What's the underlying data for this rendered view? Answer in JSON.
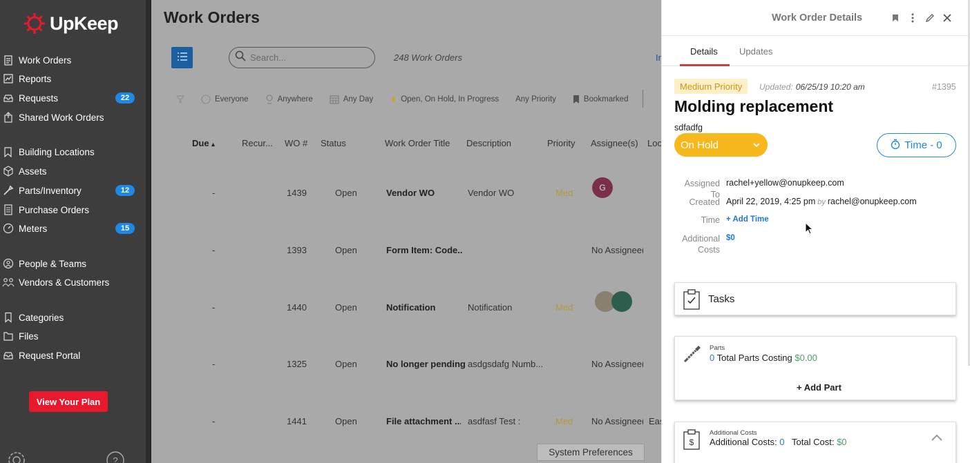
{
  "brand": {
    "name": "UpKeep"
  },
  "sidebar": {
    "items": [
      {
        "label": "Work Orders",
        "icon": "clipboard-icon"
      },
      {
        "label": "Reports",
        "icon": "chart-icon"
      },
      {
        "label": "Requests",
        "icon": "inbox-icon",
        "badge": "22"
      },
      {
        "label": "Shared Work Orders",
        "icon": "share-icon"
      },
      {
        "label": "Building Locations",
        "icon": "location-icon"
      },
      {
        "label": "Assets",
        "icon": "cube-icon"
      },
      {
        "label": "Parts/Inventory",
        "icon": "wrench-icon",
        "badge": "12"
      },
      {
        "label": "Purchase Orders",
        "icon": "document-icon"
      },
      {
        "label": "Meters",
        "icon": "gauge-icon",
        "badge": "15"
      },
      {
        "label": "People & Teams",
        "icon": "people-icon"
      },
      {
        "label": "Vendors & Customers",
        "icon": "vendors-icon"
      },
      {
        "label": "Categories",
        "icon": "bookmark-icon"
      },
      {
        "label": "Files",
        "icon": "files-icon"
      },
      {
        "label": "Request Portal",
        "icon": "portal-icon"
      }
    ],
    "plan_button": "View Your Plan"
  },
  "main": {
    "title": "Work Orders",
    "search_placeholder": "Search...",
    "count_label": "248 Work Orders",
    "cut_link": "In",
    "filters": {
      "everyone": "Everyone",
      "anywhere": "Anywhere",
      "anyday": "Any Day",
      "status": "Open, On Hold, In Progress",
      "priority": "Any Priority",
      "bookmarked": "Bookmarked"
    },
    "columns": {
      "due": "Due",
      "recurring": "Recur...",
      "wo": "WO #",
      "status": "Status",
      "title": "Work Order Title",
      "description": "Description",
      "priority": "Priority",
      "assignees": "Assignee(s)",
      "location": "Loc"
    },
    "rows": [
      {
        "due": "-",
        "wo": "1439",
        "status": "Open",
        "title": "Vendor WO",
        "description": "Vendor WO",
        "priority": "Med",
        "assignee": "",
        "avatar": "G",
        "location": ""
      },
      {
        "due": "-",
        "wo": "1393",
        "status": "Open",
        "title": "Form Item: Code...",
        "description": "",
        "priority": "",
        "assignee": "No Assignee(",
        "avatar": "",
        "location": ""
      },
      {
        "due": "-",
        "wo": "1440",
        "status": "Open",
        "title": "Notification",
        "description": "Notification",
        "priority": "Med",
        "assignee": "",
        "avatar": "",
        "location": ""
      },
      {
        "due": "-",
        "wo": "1325",
        "status": "Open",
        "title": "No longer pending",
        "description": "asdgsdafg Numb...",
        "priority": "",
        "assignee": "No Assignee(",
        "avatar": "",
        "location": ""
      },
      {
        "due": "-",
        "wo": "1441",
        "status": "Open",
        "title": "File attachment ...",
        "description": "asdfasf Test :",
        "priority": "Med",
        "assignee": "No Assignee(",
        "avatar": "",
        "location": "Eas"
      }
    ],
    "system_preferences": "System Preferences"
  },
  "details": {
    "header_title": "Work Order Details",
    "tabs": [
      "Details",
      "Updates"
    ],
    "priority": "Medium Priority",
    "updated_label": "Updated:",
    "updated_value": "06/25/19 10:20 am",
    "wo_number": "#1395",
    "title": "Molding replacement",
    "description": "sdfadfg",
    "status": "On Hold",
    "time_button": "Time - 0",
    "fields": {
      "assigned_to_label": "Assigned To",
      "assigned_to": "rachel+yellow@onupkeep.com",
      "created_label": "Created",
      "created_date": "April 22, 2019, 4:25 pm",
      "created_by_word": "by",
      "created_by": "rachel@onupkeep.com",
      "time_label": "Time",
      "add_time": "+ Add Time",
      "additional_costs_label_1": "Additional",
      "additional_costs_label_2": "Costs",
      "additional_costs_value": "$0"
    },
    "tasks": {
      "label": "Tasks"
    },
    "parts": {
      "small_label": "Parts",
      "count": "0",
      "text": "Total Parts Costing",
      "amount": "$0.00",
      "add": "+ Add Part"
    },
    "costs": {
      "small_label": "Additional Costs",
      "costs_label": "Additional Costs:",
      "costs_value": "0",
      "total_label": "Total Cost:",
      "total_value": "$0"
    }
  },
  "colors": {
    "accent": "#1e88e5",
    "brand_red": "#e8192c",
    "status_on_hold": "#f7b81d",
    "sidebar": "#3d3d3d"
  }
}
